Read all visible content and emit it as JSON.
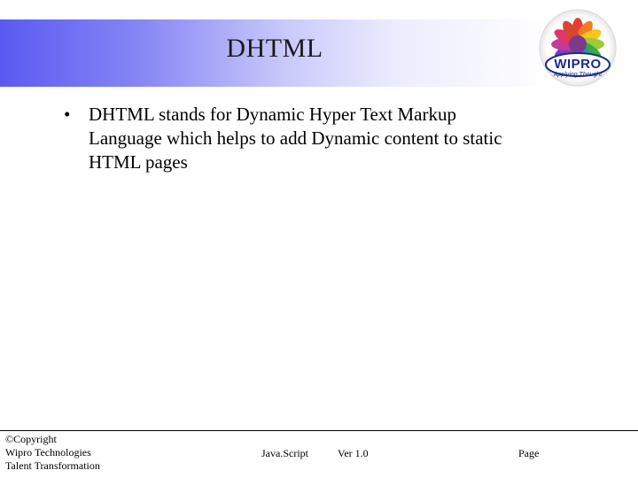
{
  "slide": {
    "title": "DHTML",
    "bullets": [
      {
        "marker": "•",
        "lines": [
          "DHTML  stands for Dynamic Hyper Text Markup",
          "Language which helps to add Dynamic content to static",
          "HTML pages"
        ]
      }
    ]
  },
  "logo": {
    "text": "WIPRO",
    "tagline": "Applying Thought"
  },
  "footer": {
    "copyright": "©Copyright",
    "company": "Wipro Technologies",
    "department": "Talent Transformation",
    "topic": "Java.Script",
    "version": "Ver 1.0",
    "page_label": "Page"
  },
  "colors": {
    "title_band_start": "#5a5af2",
    "title_band_end": "#ffffff",
    "logo_text": "#1b2a8a"
  }
}
